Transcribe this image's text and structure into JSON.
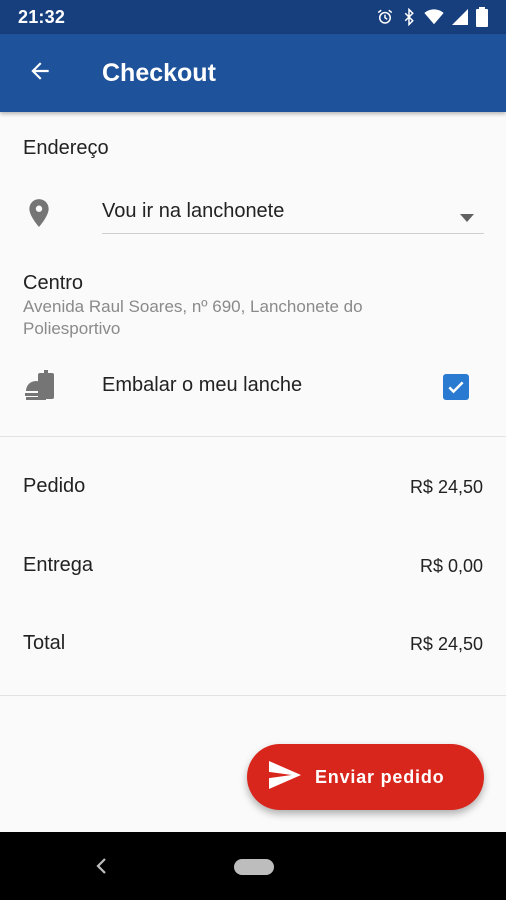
{
  "status_bar": {
    "time": "21:32",
    "icons": [
      "alarm-icon",
      "bluetooth-icon",
      "wifi-icon",
      "signal-icon",
      "battery-icon"
    ]
  },
  "app_bar": {
    "title": "Checkout",
    "back_icon": "arrow-back-icon",
    "color": "#1e529b"
  },
  "address_section": {
    "title": "Endereço",
    "pin_icon": "location-pin-icon",
    "dropdown": {
      "selected": "Vou ir na lanchonete",
      "arrow_icon": "dropdown-arrow-icon"
    },
    "place_name": "Centro",
    "place_address": "Avenida Raul Soares, nº 690, Lanchonete do Poliesportivo"
  },
  "packing": {
    "icon": "takeaway-bag-icon",
    "label": "Embalar o meu lanche",
    "checked": true
  },
  "summary": {
    "rows": [
      {
        "label": "Pedido",
        "value": "R$ 24,50"
      },
      {
        "label": "Entrega",
        "value": "R$ 0,00"
      },
      {
        "label": "Total",
        "value": "R$ 24,50"
      }
    ]
  },
  "fab": {
    "label": "Enviar pedido",
    "icon": "send-icon",
    "color": "#d9261c"
  },
  "colors": {
    "accent": "#2a7ad2",
    "status_bar": "#173f7d"
  }
}
